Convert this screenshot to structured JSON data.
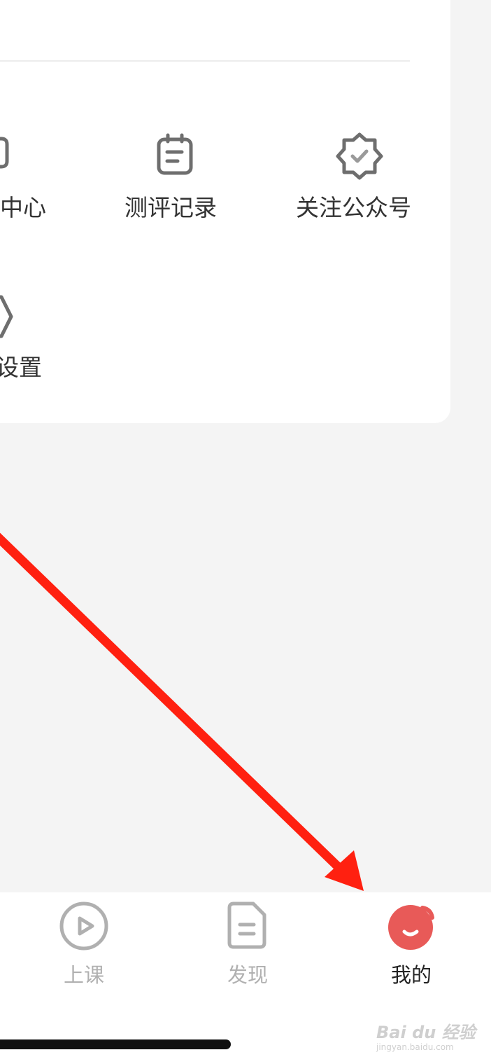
{
  "menu_items": [
    {
      "label": "中心",
      "icon": "service-center-icon"
    },
    {
      "label": "测评记录",
      "icon": "clipboard-icon"
    },
    {
      "label": "关注公众号",
      "icon": "verified-badge-icon"
    },
    {
      "label": "设置",
      "icon": "settings-hexagon-icon"
    }
  ],
  "tabbar": {
    "tabs": [
      {
        "label": "上课",
        "icon": "play-circle-icon",
        "active": false
      },
      {
        "label": "发现",
        "icon": "document-icon",
        "active": false
      },
      {
        "label": "我的",
        "icon": "profile-smile-icon",
        "active": true
      }
    ]
  },
  "colors": {
    "accent": "#e85a58",
    "arrow": "#ff2010",
    "tab_inactive": "#b0b0b0",
    "tab_active": "#222222",
    "background": "#f4f4f4"
  },
  "watermark": {
    "main": "Bai du 经验",
    "sub": "jingyan.baidu.com"
  }
}
